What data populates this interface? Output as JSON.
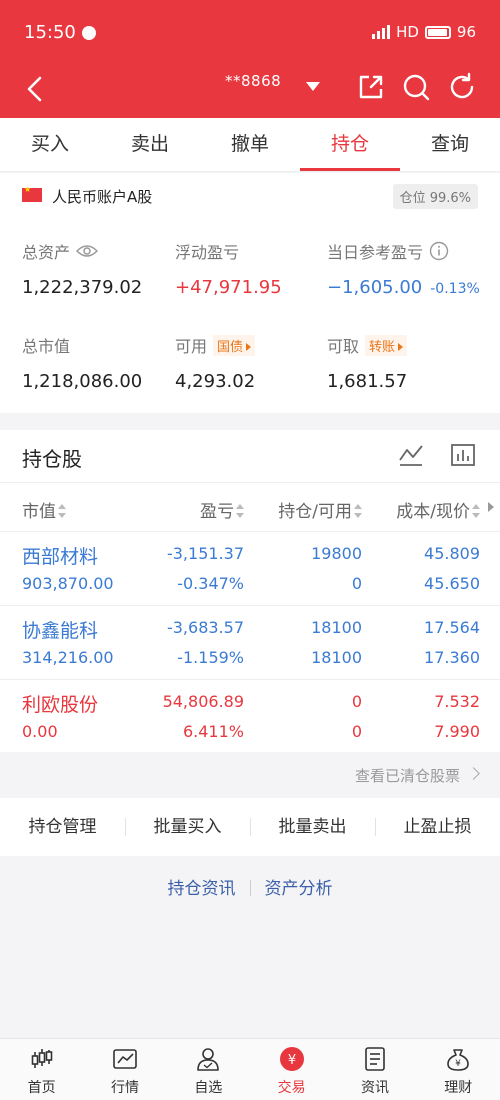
{
  "status": {
    "time": "15:50",
    "network": "HD",
    "battery": "96"
  },
  "nav": {
    "account": "**8868"
  },
  "tabs": [
    "买入",
    "卖出",
    "撤单",
    "持仓",
    "查询"
  ],
  "active_tab": 3,
  "account": {
    "name": "人民币账户A股",
    "position_ratio": "仓位 99.6%",
    "total_assets_label": "总资产",
    "total_assets": "1,222,379.02",
    "floating_pl_label": "浮动盈亏",
    "floating_pl": "+47,971.95",
    "day_pl_label": "当日参考盈亏",
    "day_pl": "−1,605.00",
    "day_pl_pct": "-0.13%",
    "market_value_label": "总市值",
    "market_value": "1,218,086.00",
    "available_label": "可用",
    "available_chip": "国债",
    "available": "4,293.02",
    "withdrawable_label": "可取",
    "withdrawable_chip": "转账",
    "withdrawable": "1,681.57"
  },
  "holdings": {
    "title": "持仓股",
    "headers": [
      "市值",
      "盈亏",
      "持仓/可用",
      "成本/现价"
    ],
    "rows": [
      {
        "name": "西部材料",
        "market_value": "903,870.00",
        "pl": "-3,151.37",
        "pl_pct": "-0.347%",
        "hold": "19800",
        "avail": "0",
        "cost": "45.809",
        "price": "45.650",
        "trend": "down"
      },
      {
        "name": "协鑫能科",
        "market_value": "314,216.00",
        "pl": "-3,683.57",
        "pl_pct": "-1.159%",
        "hold": "18100",
        "avail": "18100",
        "cost": "17.564",
        "price": "17.360",
        "trend": "down"
      },
      {
        "name": "利欧股份",
        "market_value": "0.00",
        "pl": "54,806.89",
        "pl_pct": "6.411%",
        "hold": "0",
        "avail": "0",
        "cost": "7.532",
        "price": "7.990",
        "trend": "up"
      }
    ]
  },
  "cleared_link": "查看已清仓股票",
  "actions": [
    "持仓管理",
    "批量买入",
    "批量卖出",
    "止盈止损"
  ],
  "links": [
    "持仓资讯",
    "资产分析"
  ],
  "bottom_nav": [
    "首页",
    "行情",
    "自选",
    "交易",
    "资讯",
    "理财"
  ],
  "bottom_active": 3,
  "colors": {
    "brand_red": "#e8373e",
    "down_blue": "#3b7bd3",
    "chip_orange": "#e8761a"
  }
}
